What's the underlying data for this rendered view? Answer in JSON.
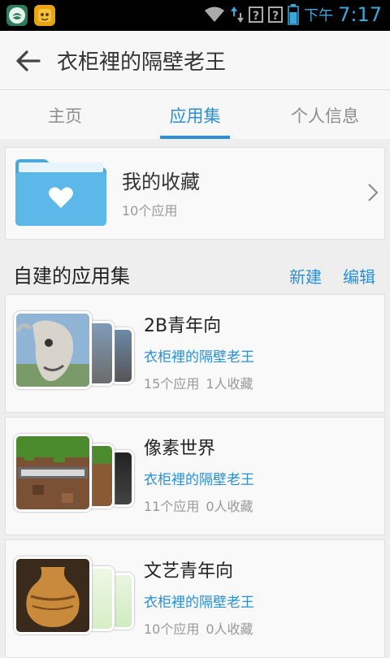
{
  "status_bar": {
    "ampm": "下午",
    "time": "7:17",
    "icons": [
      "shield-app-icon",
      "cat-app-icon",
      "wifi-icon",
      "data-arrows-icon",
      "unknown-sim-icon",
      "unknown-sim-icon",
      "battery-icon"
    ]
  },
  "header": {
    "title": "衣柜裡的隔壁老王"
  },
  "tabs": [
    {
      "label": "主页",
      "active": false
    },
    {
      "label": "应用集",
      "active": true
    },
    {
      "label": "个人信息",
      "active": false
    }
  ],
  "favorites": {
    "title": "我的收藏",
    "count": "10个应用"
  },
  "section": {
    "title": "自建的应用集",
    "new_label": "新建",
    "edit_label": "编辑"
  },
  "collections": [
    {
      "name": "2B青年向",
      "owner": "衣柜裡的隔壁老王",
      "apps": "15个应用",
      "favs": "1人收藏"
    },
    {
      "name": "像素世界",
      "owner": "衣柜裡的隔壁老王",
      "apps": "11个应用",
      "favs": "0人收藏"
    },
    {
      "name": "文艺青年向",
      "owner": "衣柜裡的隔壁老王",
      "apps": "10个应用",
      "favs": "0人收藏"
    }
  ],
  "colors": {
    "accent": "#2a8fd4",
    "folder": "#5bb8e8",
    "secondary_text": "#999999"
  }
}
